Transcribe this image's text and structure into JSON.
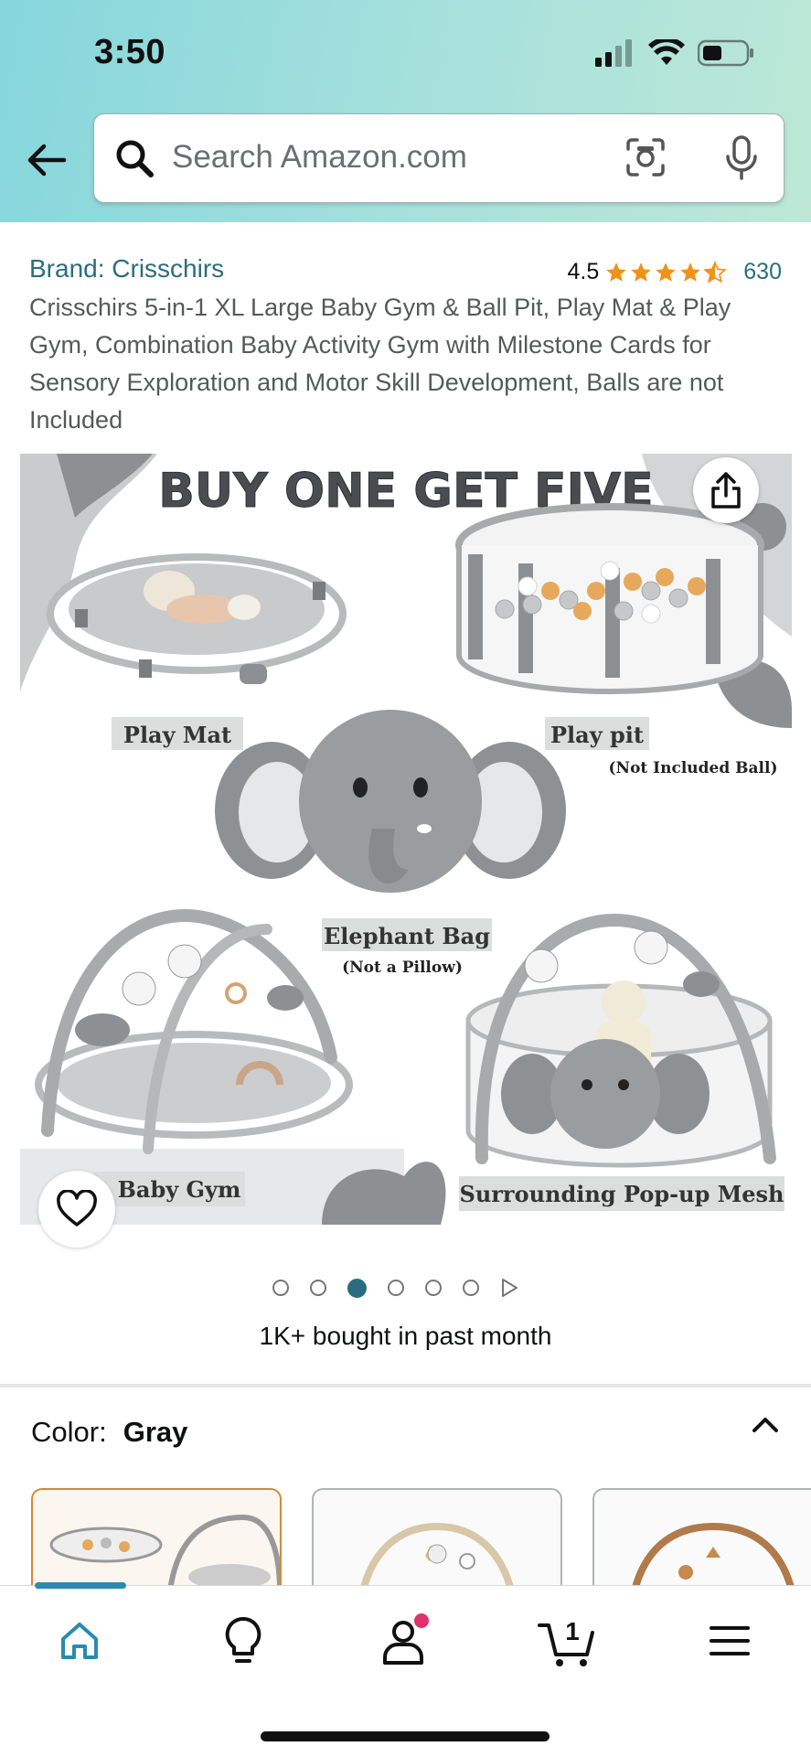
{
  "status_bar": {
    "time": "3:50"
  },
  "search": {
    "placeholder": "Search Amazon.com"
  },
  "product": {
    "brand": "Brand: Crisschirs",
    "rating": "4.5",
    "rating_count": "630",
    "title": "Crisschirs 5-in-1 XL Large Baby Gym & Ball Pit, Play Mat & Play Gym, Combination Baby Activity Gym with Milestone Cards for Sensory Exploration and Motor Skill Development, Balls are not Included"
  },
  "hero_image": {
    "headline": "BUY ONE GET FIVE",
    "labels": {
      "play_mat": "Play Mat",
      "play_pit": "Play pit",
      "play_pit_note": "(Not Included Ball)",
      "elephant_bag": "Elephant Bag",
      "elephant_note": "(Not a Pillow)",
      "baby_gym": "Baby Gym",
      "mesh": "Surrounding Pop-up Mesh"
    }
  },
  "carousel": {
    "total": 6,
    "active_index": 2
  },
  "bought_text": "1K+ bought in past month",
  "color": {
    "label": "Color:",
    "value": "Gray"
  },
  "cart": {
    "count": "1"
  },
  "colors": {
    "accent": "#2b6d80",
    "star": "#f0921a",
    "notif": "#e0316f"
  },
  "icons": [
    "back-arrow-icon",
    "search-icon",
    "camera-icon",
    "mic-icon",
    "share-icon",
    "heart-icon",
    "chevron-up-icon",
    "home-icon",
    "lightbulb-icon",
    "account-icon",
    "cart-icon",
    "menu-icon"
  ]
}
